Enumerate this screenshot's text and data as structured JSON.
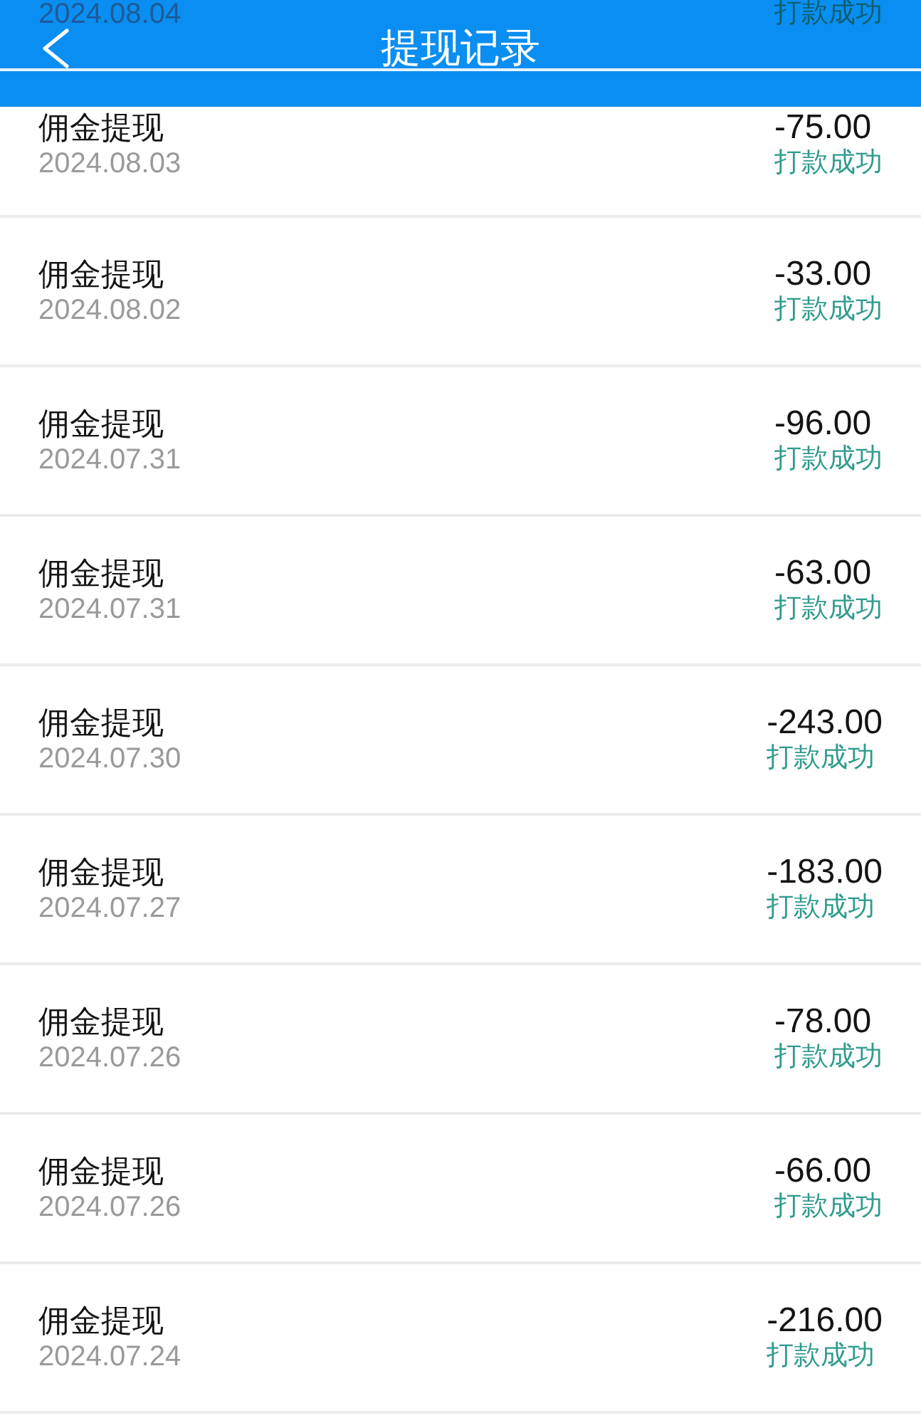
{
  "header": {
    "title": "提现记录"
  },
  "records": [
    {
      "under_header": true,
      "date": "2024.08.04",
      "status": "打款成功"
    },
    {
      "under_header": false,
      "name": "佣金提现",
      "date": "2024.08.03",
      "amount": "-75.00",
      "status": "打款成功"
    },
    {
      "under_header": false,
      "name": "佣金提现",
      "date": "2024.08.02",
      "amount": "-33.00",
      "status": "打款成功"
    },
    {
      "under_header": false,
      "name": "佣金提现",
      "date": "2024.07.31",
      "amount": "-96.00",
      "status": "打款成功"
    },
    {
      "under_header": false,
      "name": "佣金提现",
      "date": "2024.07.31",
      "amount": "-63.00",
      "status": "打款成功"
    },
    {
      "under_header": false,
      "name": "佣金提现",
      "date": "2024.07.30",
      "amount": "-243.00",
      "status": "打款成功"
    },
    {
      "under_header": false,
      "name": "佣金提现",
      "date": "2024.07.27",
      "amount": "-183.00",
      "status": "打款成功"
    },
    {
      "under_header": false,
      "name": "佣金提现",
      "date": "2024.07.26",
      "amount": "-78.00",
      "status": "打款成功"
    },
    {
      "under_header": false,
      "name": "佣金提现",
      "date": "2024.07.26",
      "amount": "-66.00",
      "status": "打款成功"
    },
    {
      "under_header": false,
      "name": "佣金提现",
      "date": "2024.07.24",
      "amount": "-216.00",
      "status": "打款成功"
    }
  ]
}
